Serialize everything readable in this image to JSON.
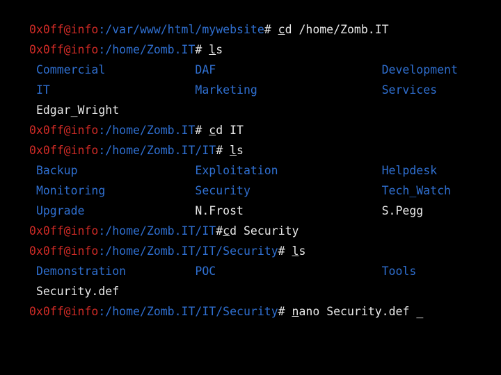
{
  "terminal": {
    "user_host": "0x0ff@info",
    "colors": {
      "prompt_red": "#d02b26",
      "path_blue": "#2f6fd0",
      "text_white": "#e8e8e8",
      "background": "#000000"
    },
    "lines": [
      {
        "type": "prompt",
        "user_host": "0x0ff@info",
        "sep": ":",
        "path": "/var/www/html/mywebsite",
        "hash": "# ",
        "cmd_first": "c",
        "cmd_rest": "d /home/Zomb.IT"
      },
      {
        "type": "prompt",
        "user_host": "0x0ff@info",
        "sep": ":",
        "path": "/home/Zomb.IT",
        "hash": "# ",
        "cmd_first": "l",
        "cmd_rest": "s"
      },
      {
        "type": "listing",
        "cells": [
          {
            "text": "Commercial",
            "kind": "dir"
          },
          {
            "text": "DAF",
            "kind": "dir"
          },
          {
            "text": "Development",
            "kind": "dir"
          }
        ]
      },
      {
        "type": "listing",
        "cells": [
          {
            "text": "IT",
            "kind": "dir"
          },
          {
            "text": "Marketing",
            "kind": "dir"
          },
          {
            "text": "Services",
            "kind": "dir"
          }
        ]
      },
      {
        "type": "listing",
        "cells": [
          {
            "text": "Edgar_Wright",
            "kind": "file"
          }
        ]
      },
      {
        "type": "prompt",
        "user_host": "0x0ff@info",
        "sep": ":",
        "path": "/home/Zomb.IT",
        "hash": "# ",
        "cmd_first": "c",
        "cmd_rest": "d IT"
      },
      {
        "type": "prompt",
        "user_host": "0x0ff@info",
        "sep": ":",
        "path": "/home/Zomb.IT/IT",
        "hash": "# ",
        "cmd_first": "l",
        "cmd_rest": "s"
      },
      {
        "type": "listing",
        "cells": [
          {
            "text": "Backup",
            "kind": "dir"
          },
          {
            "text": "Exploitation",
            "kind": "dir"
          },
          {
            "text": "Helpdesk",
            "kind": "dir"
          }
        ]
      },
      {
        "type": "listing",
        "cells": [
          {
            "text": "Monitoring",
            "kind": "dir"
          },
          {
            "text": "Security",
            "kind": "dir"
          },
          {
            "text": "Tech_Watch",
            "kind": "dir"
          }
        ]
      },
      {
        "type": "listing",
        "cells": [
          {
            "text": "Upgrade",
            "kind": "dir"
          },
          {
            "text": "N.Frost",
            "kind": "file"
          },
          {
            "text": "S.Pegg",
            "kind": "file"
          }
        ]
      },
      {
        "type": "prompt",
        "user_host": "0x0ff@info",
        "sep": ":",
        "path": "/home/Zomb.IT/IT",
        "hash": "#",
        "cmd_first": "c",
        "cmd_rest": "d Security"
      },
      {
        "type": "prompt",
        "user_host": "0x0ff@info",
        "sep": ":",
        "path": "/home/Zomb.IT/IT/Security",
        "hash": "# ",
        "cmd_first": "l",
        "cmd_rest": "s"
      },
      {
        "type": "listing",
        "cells": [
          {
            "text": "Demonstration",
            "kind": "dir"
          },
          {
            "text": "POC",
            "kind": "dir"
          },
          {
            "text": "Tools",
            "kind": "dir"
          }
        ]
      },
      {
        "type": "listing",
        "cells": [
          {
            "text": "Security.def",
            "kind": "file"
          }
        ]
      },
      {
        "type": "prompt",
        "user_host": "0x0ff@info",
        "sep": ":",
        "path": "/home/Zomb.IT/IT/Security",
        "hash": "# ",
        "cmd_first": "n",
        "cmd_rest": "ano Security.def",
        "cursor": " _"
      }
    ]
  }
}
